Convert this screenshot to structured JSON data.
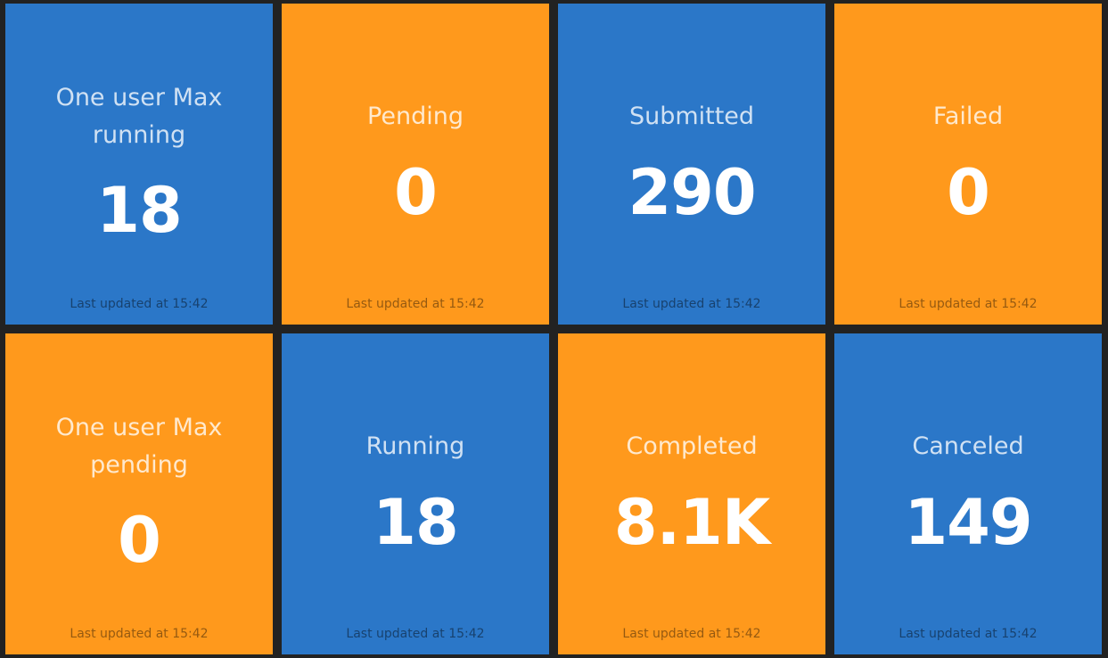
{
  "colors": {
    "background": "#222222",
    "blue": "#2b77c8",
    "orange": "#ff991c"
  },
  "updated_label": "Last updated at 15:42",
  "tiles": [
    {
      "title": "One user Max running",
      "value": "18",
      "color": "blue"
    },
    {
      "title": "Pending",
      "value": "0",
      "color": "orange"
    },
    {
      "title": "Submitted",
      "value": "290",
      "color": "blue"
    },
    {
      "title": "Failed",
      "value": "0",
      "color": "orange"
    },
    {
      "title": "One user Max pending",
      "value": "0",
      "color": "orange"
    },
    {
      "title": "Running",
      "value": "18",
      "color": "blue"
    },
    {
      "title": "Completed",
      "value": "8.1K",
      "color": "orange"
    },
    {
      "title": "Canceled",
      "value": "149",
      "color": "blue"
    }
  ]
}
